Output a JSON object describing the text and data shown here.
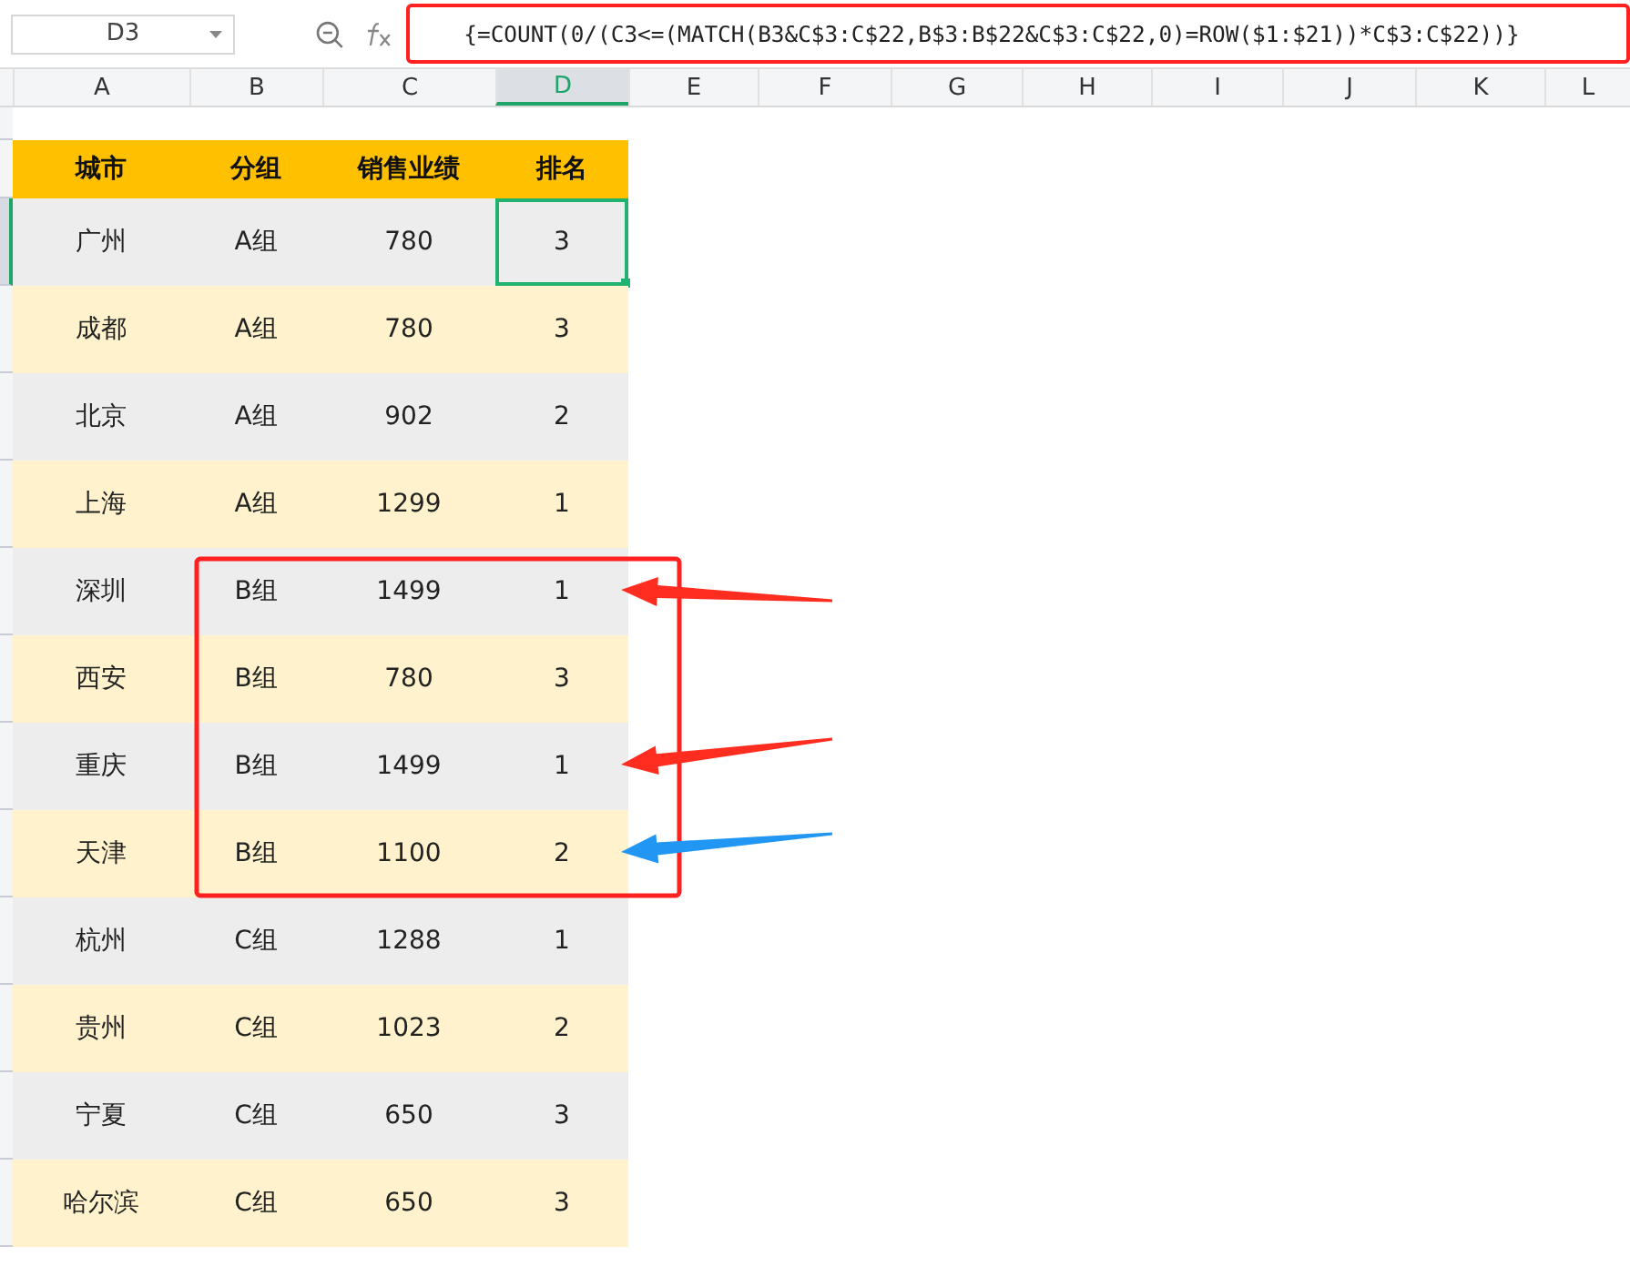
{
  "name_box": "D3",
  "formula_bar": {
    "formula": "{=COUNT(0/(C3<=(MATCH(B3&C$3:C$22,B$3:B$22&C$3:C$22,0)=ROW($1:$21))*C$3:C$22))}",
    "highlighted": true
  },
  "columns": [
    {
      "label": "A",
      "selected": false
    },
    {
      "label": "B",
      "selected": false
    },
    {
      "label": "C",
      "selected": false
    },
    {
      "label": "D",
      "selected": true
    },
    {
      "label": "E",
      "selected": false
    },
    {
      "label": "F",
      "selected": false
    },
    {
      "label": "G",
      "selected": false
    },
    {
      "label": "H",
      "selected": false
    },
    {
      "label": "I",
      "selected": false
    },
    {
      "label": "J",
      "selected": false
    },
    {
      "label": "K",
      "selected": false
    },
    {
      "label": "L",
      "selected": false
    }
  ],
  "table": {
    "header": [
      "城市",
      "分组",
      "销售业绩",
      "排名"
    ],
    "rows": [
      {
        "cells": [
          "广州",
          "A组",
          "780",
          "3"
        ],
        "selected": true
      },
      {
        "cells": [
          "成都",
          "A组",
          "780",
          "3"
        ],
        "selected": false
      },
      {
        "cells": [
          "北京",
          "A组",
          "902",
          "2"
        ],
        "selected": false
      },
      {
        "cells": [
          "上海",
          "A组",
          "1299",
          "1"
        ],
        "selected": false
      },
      {
        "cells": [
          "深圳",
          "B组",
          "1499",
          "1"
        ],
        "selected": false
      },
      {
        "cells": [
          "西安",
          "B组",
          "780",
          "3"
        ],
        "selected": false
      },
      {
        "cells": [
          "重庆",
          "B组",
          "1499",
          "1"
        ],
        "selected": false
      },
      {
        "cells": [
          "天津",
          "B组",
          "1100",
          "2"
        ],
        "selected": false
      },
      {
        "cells": [
          "杭州",
          "C组",
          "1288",
          "1"
        ],
        "selected": false
      },
      {
        "cells": [
          "贵州",
          "C组",
          "1023",
          "2"
        ],
        "selected": false
      },
      {
        "cells": [
          "宁夏",
          "C组",
          "650",
          "3"
        ],
        "selected": false
      },
      {
        "cells": [
          "哈尔滨",
          "C组",
          "650",
          "3"
        ],
        "selected": false
      }
    ]
  },
  "annotations": [
    {
      "kind": "frame",
      "color": "#ff2020"
    },
    {
      "kind": "arrow",
      "color": "#ff2d1f"
    },
    {
      "kind": "arrow",
      "color": "#ff2d1f"
    },
    {
      "kind": "arrow",
      "color": "#2196f3"
    }
  ]
}
